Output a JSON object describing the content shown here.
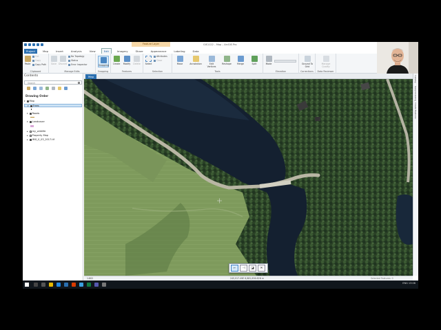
{
  "window": {
    "context_tab": "Feature Layer",
    "title": "GIS1122 – Map – ArcGIS Pro"
  },
  "ribbon_tabs": [
    "Project",
    "Map",
    "Insert",
    "Analysis",
    "View",
    "Edit",
    "Imagery",
    "Share",
    "Appearance",
    "Labeling",
    "Data"
  ],
  "ribbon": {
    "clipboard": {
      "label": "Clipboard",
      "paste": "Paste",
      "cut": "Cut",
      "copy": "Copy",
      "copy_path": "Copy Path"
    },
    "manage_edits": {
      "label": "Manage Edits",
      "save": "Save",
      "discard": "Discard",
      "no_topology": "No Topology",
      "status": "Status",
      "error_inspector": "Error Inspector"
    },
    "snapping": {
      "label": "Snapping",
      "snapping": "Snapping"
    },
    "features": {
      "label": "Features",
      "create": "Create",
      "modify": "Modify",
      "delete": "Delete"
    },
    "selection": {
      "label": "Selection",
      "select": "Select",
      "attributes": "Attributes",
      "clear": "Clear"
    },
    "tools": {
      "label": "Tools",
      "move": "Move",
      "annotation": "Annotation",
      "edit_vertices": "Edit Vertices",
      "reshape": "Reshape",
      "merge": "Merge",
      "split": "Split"
    },
    "elevation": {
      "label": "Elevation",
      "mode": "Mode"
    },
    "corrections": {
      "label": "Corrections",
      "ground_to_grid": "Ground To Grid"
    },
    "data_reviewer": {
      "label": "Data Reviewer",
      "manage_quality": "Manage Quality"
    }
  },
  "contents": {
    "title": "Contents",
    "search_placeholder": "Search",
    "drawing_order": "Drawing Order",
    "layers": [
      {
        "name": "Map",
        "checked": true
      },
      {
        "name": "Trees",
        "checked": true,
        "selected": true
      },
      {
        "name": "Roads",
        "checked": true
      },
      {
        "name": "Landcover",
        "checked": true
      },
      {
        "name": "my_wildlife",
        "checked": false
      },
      {
        "name": "Property Map",
        "checked": false
      },
      {
        "name": "IMG_0_03_2017.tif",
        "checked": true
      }
    ]
  },
  "map": {
    "tab": "Map",
    "scale": "1:802",
    "coordinates": "245,917.49E 6,881,856.62N m",
    "selected_features": "Selected Features: 0"
  },
  "dock": {
    "items": [
      "Catalog",
      "Geoprocessing",
      "Create Features"
    ]
  },
  "taskbar": {
    "time": "13:06",
    "date": "",
    "lang": "ENG"
  },
  "colors": {
    "accent": "#2a6fb0",
    "context_tab": "#f7d8a8",
    "selection": "#cce2f5"
  }
}
